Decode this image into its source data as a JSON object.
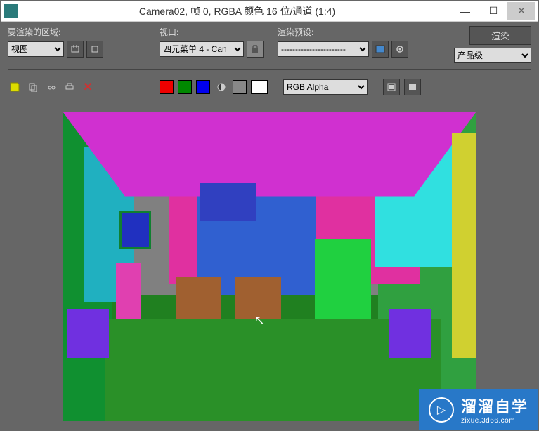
{
  "window": {
    "title": "Camera02, 帧 0, RGBA 颜色 16 位/通道 (1:4)"
  },
  "toolbar": {
    "area_label": "要渲染的区域:",
    "area_selected": "视图",
    "viewport_label": "视口:",
    "viewport_selected": "四元菜单 4 - Can",
    "preset_label": "渲染预设:",
    "preset_selected": "-----------------------",
    "render_label": "渲染",
    "output_selected": "产品级"
  },
  "row2": {
    "channel_selected": "RGB Alpha"
  },
  "colors": {
    "red": "#e00000",
    "green": "#008800",
    "blue": "#0000e0"
  },
  "watermark": {
    "main": "溜溜自学",
    "sub": "zixue.3d66.com"
  }
}
